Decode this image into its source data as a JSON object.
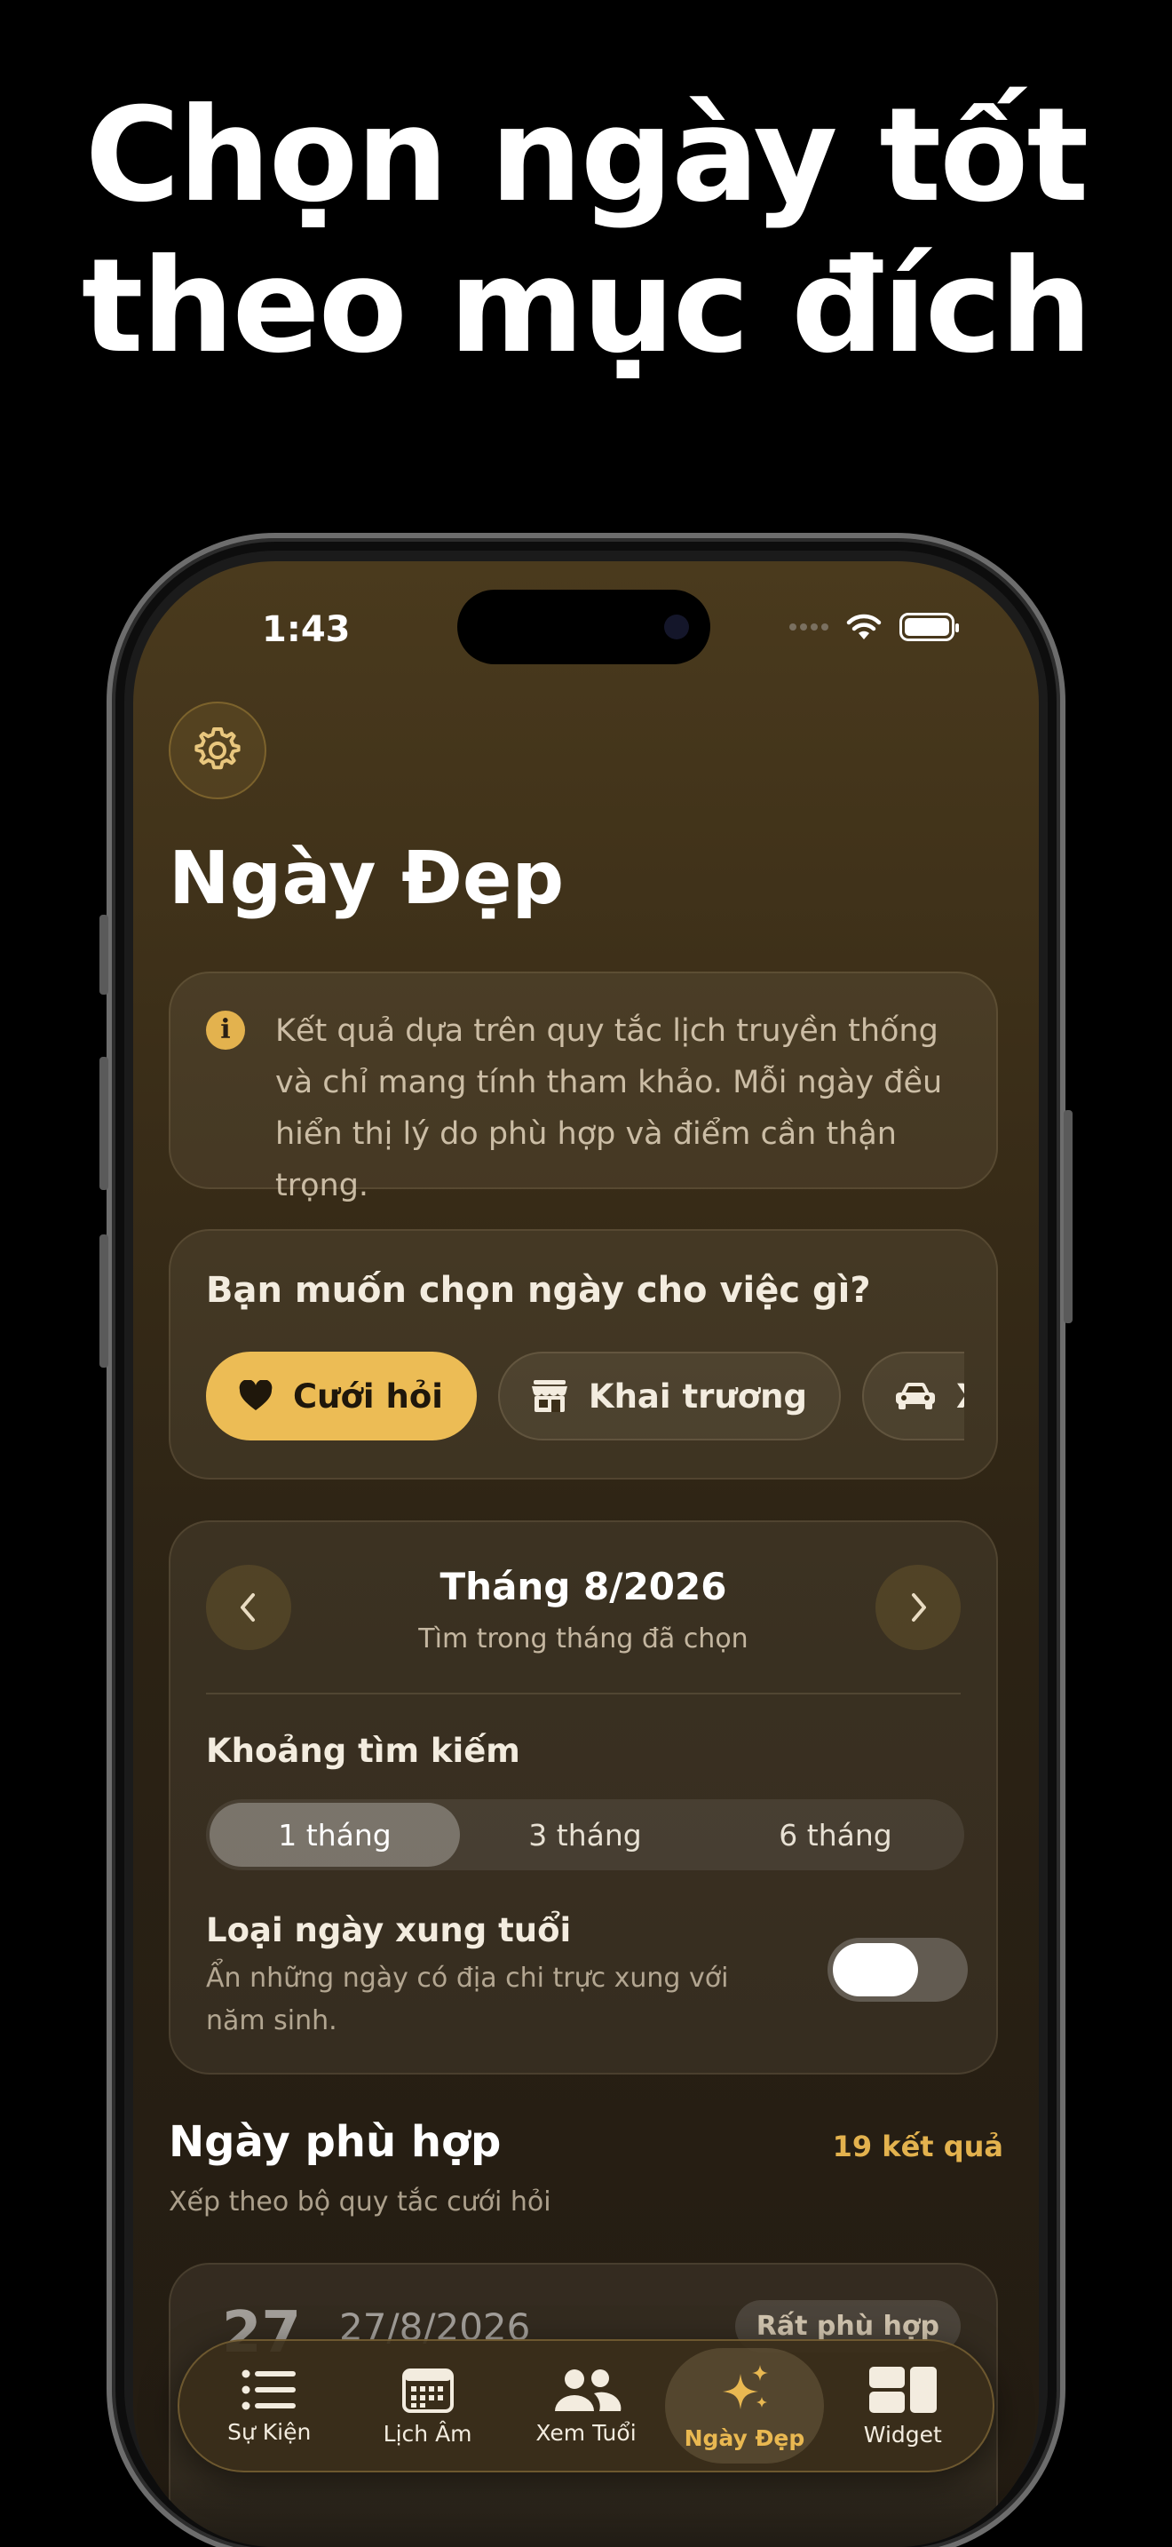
{
  "headline": {
    "line1": "Chọn ngày tốt",
    "line2": "theo mục đích"
  },
  "status_bar": {
    "time": "1:43"
  },
  "page": {
    "title": "Ngày Đẹp"
  },
  "info": {
    "text": "Kết quả dựa trên quy tắc lịch truyền thống và chỉ mang tính tham khảo. Mỗi ngày đều hiển thị lý do phù hợp và điểm cần thận trọng."
  },
  "purpose": {
    "heading": "Bạn muốn chọn ngày cho việc gì?",
    "chips": [
      {
        "label": "Cưới hỏi",
        "icon": "heart-icon",
        "selected": true
      },
      {
        "label": "Khai trương",
        "icon": "storefront-icon",
        "selected": false
      },
      {
        "label": "Xuất hành",
        "icon": "car-icon",
        "selected": false
      }
    ]
  },
  "month": {
    "title": "Tháng 8/2026",
    "subtitle": "Tìm trong tháng đã chọn",
    "range_label": "Khoảng tìm kiếm",
    "ranges": [
      {
        "label": "1 tháng",
        "selected": true
      },
      {
        "label": "3 tháng",
        "selected": false
      },
      {
        "label": "6 tháng",
        "selected": false
      }
    ],
    "toggle_title": "Loại ngày xung tuổi",
    "toggle_desc": "Ẩn những ngày có địa chi trực xung với năm sinh.",
    "toggle_on": false
  },
  "results": {
    "title": "Ngày phù hợp",
    "count": "19 kết quả",
    "subtitle": "Xếp theo bộ quy tắc cưới hỏi",
    "first": {
      "day": "27",
      "date": "27/8/2026",
      "badge": "Rất phù hợp"
    }
  },
  "tabbar": {
    "tabs": [
      {
        "label": "Sự Kiện",
        "icon": "list-icon",
        "active": false
      },
      {
        "label": "Lịch Âm",
        "icon": "calendar-icon",
        "active": false
      },
      {
        "label": "Xem Tuổi",
        "icon": "people-icon",
        "active": false
      },
      {
        "label": "Ngày Đẹp",
        "icon": "sparkles-icon",
        "active": true
      },
      {
        "label": "Widget",
        "icon": "widget-icon",
        "active": false
      }
    ]
  },
  "colors": {
    "accent": "#ecbc55",
    "accent_text": "#e3b24e",
    "background": "#2b2214"
  }
}
